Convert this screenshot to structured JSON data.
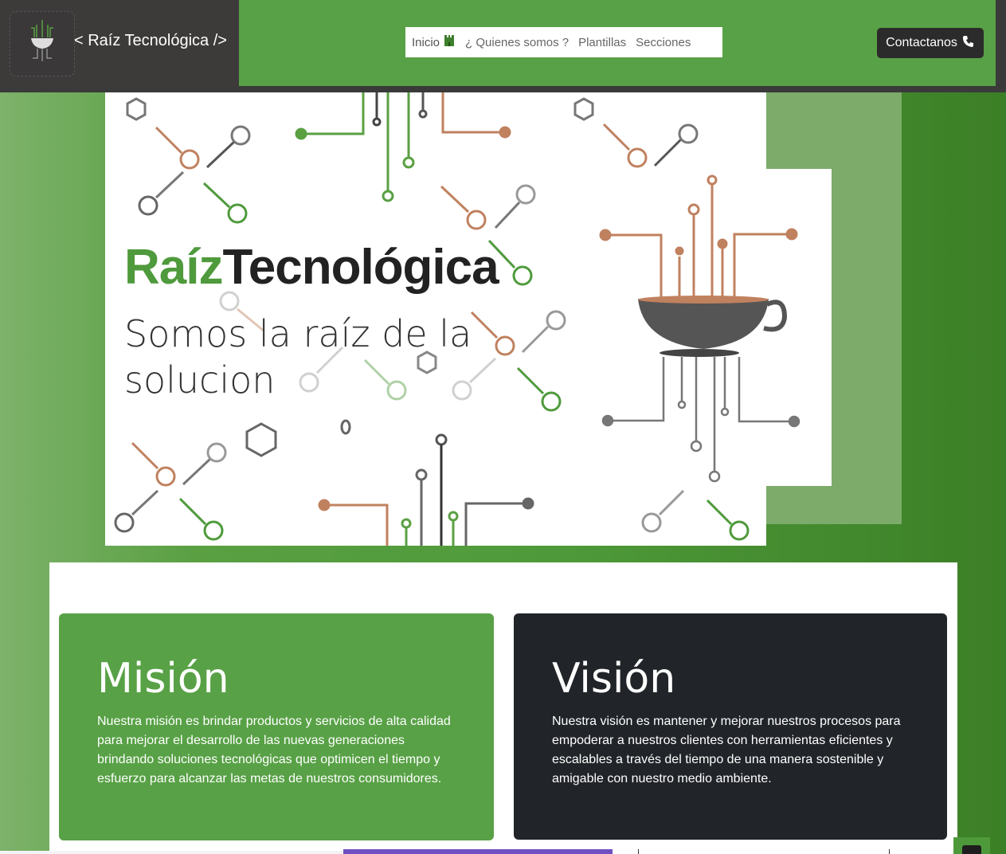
{
  "header": {
    "brand": "< Raíz Tecnológica />",
    "nav": [
      "Inicio",
      "¿ Quienes somos ?",
      "Plantillas",
      "Secciones"
    ],
    "contact_label": "Contactanos"
  },
  "hero": {
    "title_part1": "Raíz",
    "title_part2": "Tecnológica",
    "subtitle": "Somos la raíz de la solucion"
  },
  "mision": {
    "title": "Misión",
    "text": "Nuestra misión es brindar productos y servicios de alta calidad para mejorar el desarrollo de las nuevas generaciones brindando soluciones tecnológicas que optimicen el tiempo y esfuerzo para alcanzar las metas de nuestros consumidores."
  },
  "vision": {
    "title": "Visión",
    "text": "Nuestra visión es mantener y mejorar nuestros procesos para empoderar a nuestros clientes con herramientas eficientes y escalables a través del tiempo de una manera sostenible y amigable con nuestro medio ambiente."
  },
  "colors": {
    "green": "#58a146",
    "dark": "#212429",
    "copper": "#c0815f"
  },
  "icons": {
    "home": "castle-icon",
    "contact": "phone-icon",
    "scroll": "arrow-up-icon"
  }
}
